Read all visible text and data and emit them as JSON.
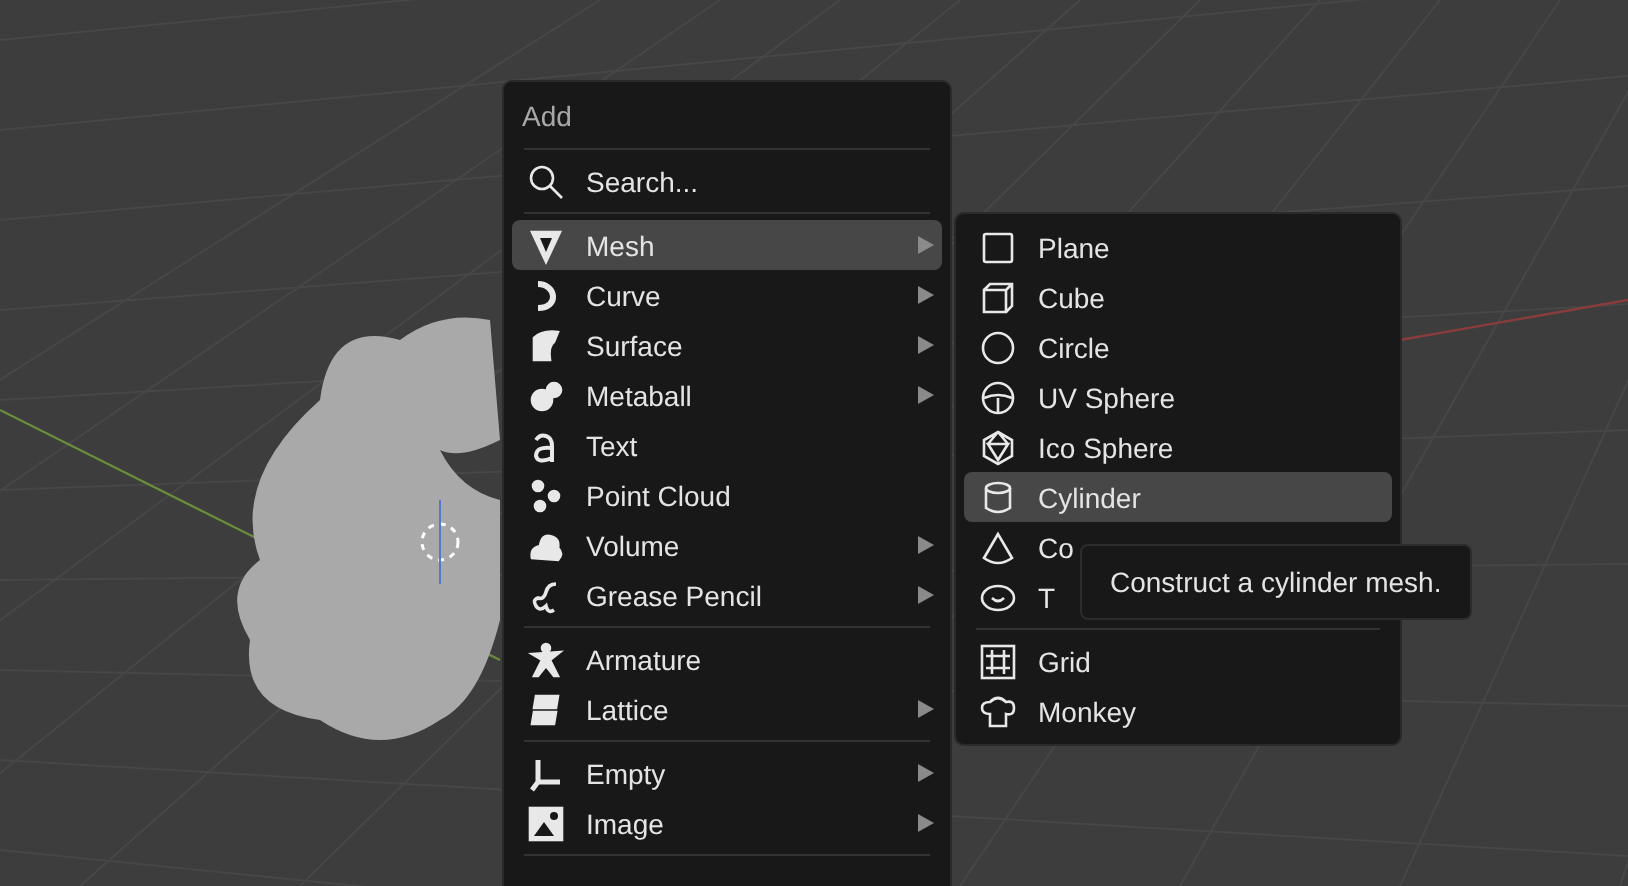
{
  "menu": {
    "title": "Add",
    "search": {
      "label": "Search..."
    },
    "groups": [
      [
        {
          "label": "Mesh",
          "submenu": true,
          "selected": true
        },
        {
          "label": "Curve",
          "submenu": true,
          "selected": false
        },
        {
          "label": "Surface",
          "submenu": true,
          "selected": false
        },
        {
          "label": "Metaball",
          "submenu": true,
          "selected": false
        },
        {
          "label": "Text",
          "submenu": false,
          "selected": false
        },
        {
          "label": "Point Cloud",
          "submenu": false,
          "selected": false
        },
        {
          "label": "Volume",
          "submenu": true,
          "selected": false
        },
        {
          "label": "Grease Pencil",
          "submenu": true,
          "selected": false
        }
      ],
      [
        {
          "label": "Armature",
          "submenu": false,
          "selected": false
        },
        {
          "label": "Lattice",
          "submenu": true,
          "selected": false
        }
      ],
      [
        {
          "label": "Empty",
          "submenu": true,
          "selected": false
        },
        {
          "label": "Image",
          "submenu": true,
          "selected": false
        }
      ]
    ]
  },
  "submenu": {
    "groups": [
      [
        {
          "label": "Plane",
          "selected": false
        },
        {
          "label": "Cube",
          "selected": false
        },
        {
          "label": "Circle",
          "selected": false
        },
        {
          "label": "UV Sphere",
          "selected": false
        },
        {
          "label": "Ico Sphere",
          "selected": false
        },
        {
          "label": "Cylinder",
          "selected": true
        },
        {
          "label": "Co",
          "selected": false
        },
        {
          "label": "T",
          "selected": false
        }
      ],
      [
        {
          "label": "Grid",
          "selected": false
        },
        {
          "label": "Monkey",
          "selected": false
        }
      ]
    ]
  },
  "tooltip": {
    "text": "Construct a cylinder mesh."
  }
}
